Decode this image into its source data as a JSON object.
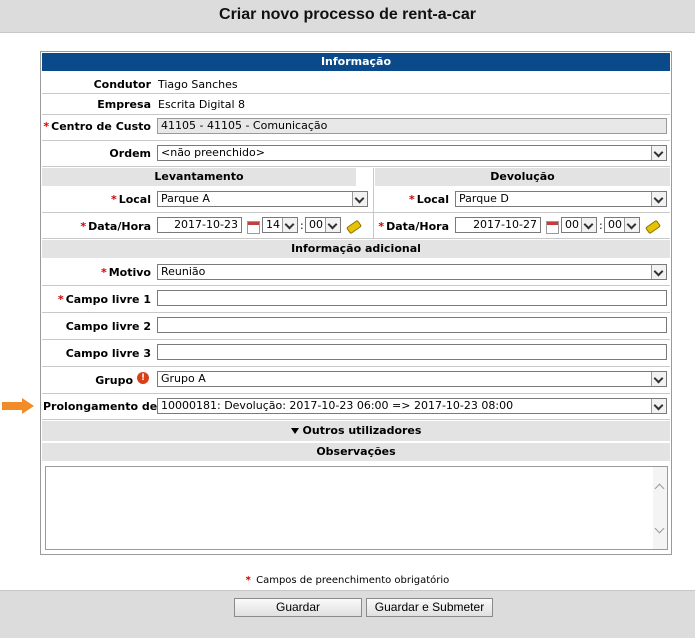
{
  "page": {
    "title": "Criar novo processo de rent-a-car"
  },
  "sections": {
    "informacao": "Informação",
    "levantamento": "Levantamento",
    "devolucao": "Devolução",
    "info_adicional": "Informação adicional",
    "outros_utilizadores": "Outros utilizadores",
    "observacoes": "Observações"
  },
  "fields": {
    "condutor": {
      "label": "Condutor",
      "value": "Tiago Sanches"
    },
    "empresa": {
      "label": "Empresa",
      "value": "Escrita Digital 8"
    },
    "centro_custo": {
      "label": "Centro de Custo",
      "value": "41105 - 41105 - Comunicação"
    },
    "ordem": {
      "label": "Ordem",
      "value": "<não preenchido>"
    },
    "lev_local": {
      "label": "Local",
      "value": "Parque A"
    },
    "lev_datahora": {
      "label": "Data/Hora",
      "date": "2017-10-23",
      "hour": "14",
      "minute": "00"
    },
    "dev_local": {
      "label": "Local",
      "value": "Parque D"
    },
    "dev_datahora": {
      "label": "Data/Hora",
      "date": "2017-10-27",
      "hour": "00",
      "minute": "00"
    },
    "motivo": {
      "label": "Motivo",
      "value": "Reunião"
    },
    "campo1": {
      "label": "Campo livre 1",
      "value": ""
    },
    "campo2": {
      "label": "Campo livre 2",
      "value": ""
    },
    "campo3": {
      "label": "Campo livre 3",
      "value": ""
    },
    "grupo": {
      "label": "Grupo",
      "value": "Grupo A"
    },
    "prolongamento": {
      "label": "Prolongamento de",
      "value": "10000181: Devolução: 2017-10-23 06:00 => 2017-10-23 08:00"
    }
  },
  "symbols": {
    "required": "*",
    "colon": ":",
    "warning": "!"
  },
  "legend": "Campos de preenchimento obrigatório",
  "buttons": {
    "save": "Guardar",
    "save_submit": "Guardar e Submeter"
  },
  "colors": {
    "header_blue": "#0a4a8a",
    "required_red": "#d00000",
    "arrow_orange": "#f28c28"
  }
}
